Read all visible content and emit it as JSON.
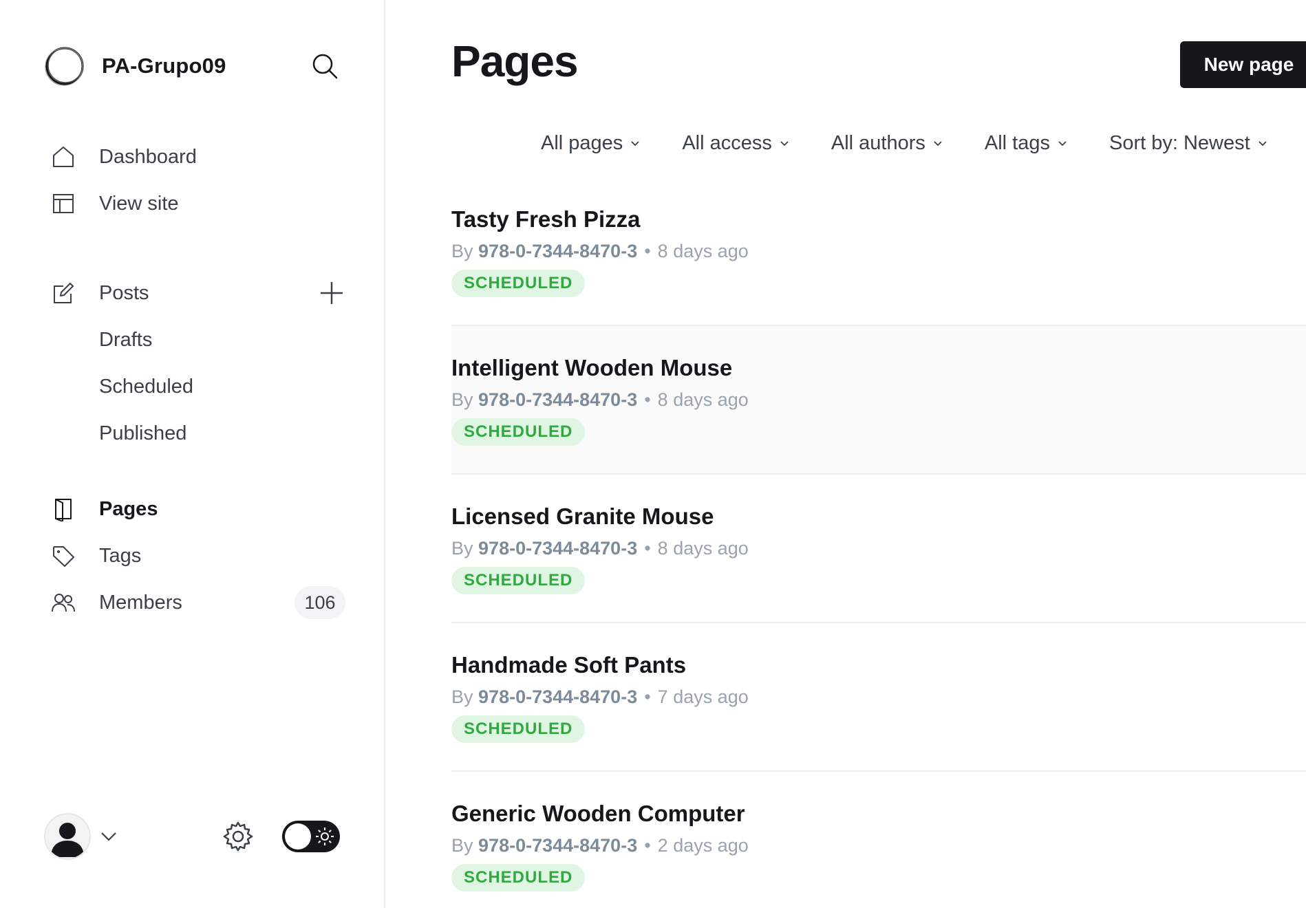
{
  "sidebar": {
    "site_name": "PA-Grupo09",
    "nav_top": [
      {
        "label": "Dashboard",
        "icon": "home-icon"
      },
      {
        "label": "View site",
        "icon": "layout-icon"
      }
    ],
    "posts": {
      "label": "Posts",
      "icon": "edit-icon",
      "sub": [
        {
          "label": "Drafts"
        },
        {
          "label": "Scheduled"
        },
        {
          "label": "Published"
        }
      ]
    },
    "nav_bottom": [
      {
        "label": "Pages",
        "icon": "page-icon",
        "active": true
      },
      {
        "label": "Tags",
        "icon": "tag-icon"
      },
      {
        "label": "Members",
        "icon": "members-icon",
        "count": "106"
      }
    ]
  },
  "main": {
    "title": "Pages",
    "new_button": "New page",
    "filters": [
      "All pages",
      "All access",
      "All authors",
      "All tags",
      "Sort by: Newest"
    ],
    "pages": [
      {
        "title": "Tasty Fresh Pizza",
        "by": "By",
        "author": "978-0-7344-8470-3",
        "time": "8 days ago",
        "status": "SCHEDULED"
      },
      {
        "title": "Intelligent Wooden Mouse",
        "by": "By",
        "author": "978-0-7344-8470-3",
        "time": "8 days ago",
        "status": "SCHEDULED"
      },
      {
        "title": "Licensed Granite Mouse",
        "by": "By",
        "author": "978-0-7344-8470-3",
        "time": "8 days ago",
        "status": "SCHEDULED"
      },
      {
        "title": "Handmade Soft Pants",
        "by": "By",
        "author": "978-0-7344-8470-3",
        "time": "7 days ago",
        "status": "SCHEDULED"
      },
      {
        "title": "Generic Wooden Computer",
        "by": "By",
        "author": "978-0-7344-8470-3",
        "time": "2 days ago",
        "status": "SCHEDULED"
      }
    ]
  },
  "colors": {
    "accent_dark": "#15171a",
    "status_green": "#30a93f",
    "status_green_bg": "#e1f5e4",
    "meta_gray": "#99a3ad"
  }
}
